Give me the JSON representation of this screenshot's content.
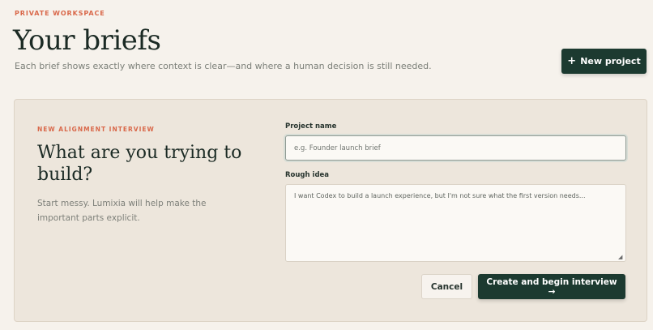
{
  "header": {
    "eyebrow": "PRIVATE WORKSPACE",
    "title": "Your briefs",
    "subtitle": "Each brief shows exactly where context is clear—and where a human decision is still needed.",
    "new_project_icon": "+",
    "new_project_label": "New project"
  },
  "interview": {
    "eyebrow": "NEW ALIGNMENT INTERVIEW",
    "heading": "What are you trying to build?",
    "description": "Start messy. Lumixia will help make the important parts explicit.",
    "project_name": {
      "label": "Project name",
      "placeholder": "e.g. Founder launch brief",
      "value": ""
    },
    "rough_idea": {
      "label": "Rough idea",
      "placeholder": "I want Codex to build a launch experience, but I'm not sure what the first version needs...",
      "value": ""
    },
    "cancel_label": "Cancel",
    "create_label": "Create and begin interview →"
  },
  "colors": {
    "background": "#f6f2ec",
    "panel": "#ede6dc",
    "accent": "#d9684a",
    "primary_button": "#1c3a30"
  }
}
